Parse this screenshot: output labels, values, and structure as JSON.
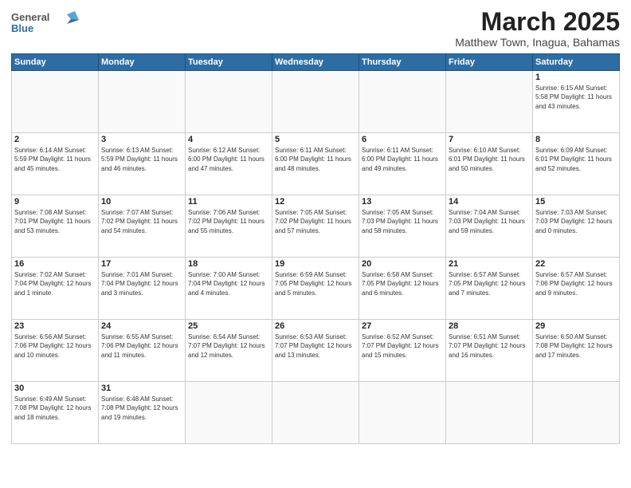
{
  "header": {
    "logo_general": "General",
    "logo_blue": "Blue",
    "month_title": "March 2025",
    "subtitle": "Matthew Town, Inagua, Bahamas"
  },
  "weekdays": [
    "Sunday",
    "Monday",
    "Tuesday",
    "Wednesday",
    "Thursday",
    "Friday",
    "Saturday"
  ],
  "weeks": [
    [
      {
        "day": "",
        "info": ""
      },
      {
        "day": "",
        "info": ""
      },
      {
        "day": "",
        "info": ""
      },
      {
        "day": "",
        "info": ""
      },
      {
        "day": "",
        "info": ""
      },
      {
        "day": "",
        "info": ""
      },
      {
        "day": "1",
        "info": "Sunrise: 6:15 AM\nSunset: 5:58 PM\nDaylight: 11 hours\nand 43 minutes."
      }
    ],
    [
      {
        "day": "2",
        "info": "Sunrise: 6:14 AM\nSunset: 5:59 PM\nDaylight: 11 hours\nand 45 minutes."
      },
      {
        "day": "3",
        "info": "Sunrise: 6:13 AM\nSunset: 5:59 PM\nDaylight: 11 hours\nand 46 minutes."
      },
      {
        "day": "4",
        "info": "Sunrise: 6:12 AM\nSunset: 6:00 PM\nDaylight: 11 hours\nand 47 minutes."
      },
      {
        "day": "5",
        "info": "Sunrise: 6:11 AM\nSunset: 6:00 PM\nDaylight: 11 hours\nand 48 minutes."
      },
      {
        "day": "6",
        "info": "Sunrise: 6:11 AM\nSunset: 6:00 PM\nDaylight: 11 hours\nand 49 minutes."
      },
      {
        "day": "7",
        "info": "Sunrise: 6:10 AM\nSunset: 6:01 PM\nDaylight: 11 hours\nand 50 minutes."
      },
      {
        "day": "8",
        "info": "Sunrise: 6:09 AM\nSunset: 6:01 PM\nDaylight: 11 hours\nand 52 minutes."
      }
    ],
    [
      {
        "day": "9",
        "info": "Sunrise: 7:08 AM\nSunset: 7:01 PM\nDaylight: 11 hours\nand 53 minutes."
      },
      {
        "day": "10",
        "info": "Sunrise: 7:07 AM\nSunset: 7:02 PM\nDaylight: 11 hours\nand 54 minutes."
      },
      {
        "day": "11",
        "info": "Sunrise: 7:06 AM\nSunset: 7:02 PM\nDaylight: 11 hours\nand 55 minutes."
      },
      {
        "day": "12",
        "info": "Sunrise: 7:05 AM\nSunset: 7:02 PM\nDaylight: 11 hours\nand 57 minutes."
      },
      {
        "day": "13",
        "info": "Sunrise: 7:05 AM\nSunset: 7:03 PM\nDaylight: 11 hours\nand 58 minutes."
      },
      {
        "day": "14",
        "info": "Sunrise: 7:04 AM\nSunset: 7:03 PM\nDaylight: 11 hours\nand 59 minutes."
      },
      {
        "day": "15",
        "info": "Sunrise: 7:03 AM\nSunset: 7:03 PM\nDaylight: 12 hours\nand 0 minutes."
      }
    ],
    [
      {
        "day": "16",
        "info": "Sunrise: 7:02 AM\nSunset: 7:04 PM\nDaylight: 12 hours\nand 1 minute."
      },
      {
        "day": "17",
        "info": "Sunrise: 7:01 AM\nSunset: 7:04 PM\nDaylight: 12 hours\nand 3 minutes."
      },
      {
        "day": "18",
        "info": "Sunrise: 7:00 AM\nSunset: 7:04 PM\nDaylight: 12 hours\nand 4 minutes."
      },
      {
        "day": "19",
        "info": "Sunrise: 6:59 AM\nSunset: 7:05 PM\nDaylight: 12 hours\nand 5 minutes."
      },
      {
        "day": "20",
        "info": "Sunrise: 6:58 AM\nSunset: 7:05 PM\nDaylight: 12 hours\nand 6 minutes."
      },
      {
        "day": "21",
        "info": "Sunrise: 6:57 AM\nSunset: 7:05 PM\nDaylight: 12 hours\nand 7 minutes."
      },
      {
        "day": "22",
        "info": "Sunrise: 6:57 AM\nSunset: 7:06 PM\nDaylight: 12 hours\nand 9 minutes."
      }
    ],
    [
      {
        "day": "23",
        "info": "Sunrise: 6:56 AM\nSunset: 7:06 PM\nDaylight: 12 hours\nand 10 minutes."
      },
      {
        "day": "24",
        "info": "Sunrise: 6:55 AM\nSunset: 7:06 PM\nDaylight: 12 hours\nand 11 minutes."
      },
      {
        "day": "25",
        "info": "Sunrise: 6:54 AM\nSunset: 7:07 PM\nDaylight: 12 hours\nand 12 minutes."
      },
      {
        "day": "26",
        "info": "Sunrise: 6:53 AM\nSunset: 7:07 PM\nDaylight: 12 hours\nand 13 minutes."
      },
      {
        "day": "27",
        "info": "Sunrise: 6:52 AM\nSunset: 7:07 PM\nDaylight: 12 hours\nand 15 minutes."
      },
      {
        "day": "28",
        "info": "Sunrise: 6:51 AM\nSunset: 7:07 PM\nDaylight: 12 hours\nand 16 minutes."
      },
      {
        "day": "29",
        "info": "Sunrise: 6:50 AM\nSunset: 7:08 PM\nDaylight: 12 hours\nand 17 minutes."
      }
    ],
    [
      {
        "day": "30",
        "info": "Sunrise: 6:49 AM\nSunset: 7:08 PM\nDaylight: 12 hours\nand 18 minutes."
      },
      {
        "day": "31",
        "info": "Sunrise: 6:48 AM\nSunset: 7:08 PM\nDaylight: 12 hours\nand 19 minutes."
      },
      {
        "day": "",
        "info": ""
      },
      {
        "day": "",
        "info": ""
      },
      {
        "day": "",
        "info": ""
      },
      {
        "day": "",
        "info": ""
      },
      {
        "day": "",
        "info": ""
      }
    ]
  ]
}
